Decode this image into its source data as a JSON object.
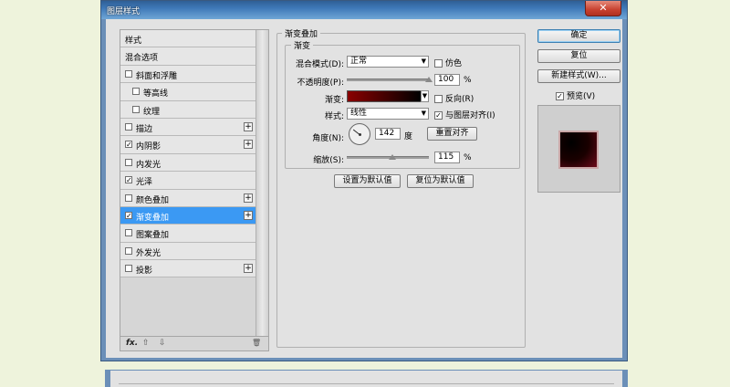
{
  "window": {
    "title": "图层样式",
    "close_symbol": "✕"
  },
  "styles_list": [
    {
      "label": "样式",
      "checkbox": false,
      "checked": false,
      "plus": false,
      "indent": 0,
      "selected": false
    },
    {
      "label": "混合选项",
      "checkbox": false,
      "checked": false,
      "plus": false,
      "indent": 0,
      "selected": false
    },
    {
      "label": "斜面和浮雕",
      "checkbox": true,
      "checked": false,
      "plus": false,
      "indent": 0,
      "selected": false
    },
    {
      "label": "等高线",
      "checkbox": true,
      "checked": false,
      "plus": false,
      "indent": 1,
      "selected": false
    },
    {
      "label": "纹理",
      "checkbox": true,
      "checked": false,
      "plus": false,
      "indent": 1,
      "selected": false
    },
    {
      "label": "描边",
      "checkbox": true,
      "checked": false,
      "plus": true,
      "indent": 0,
      "selected": false
    },
    {
      "label": "内阴影",
      "checkbox": true,
      "checked": true,
      "plus": true,
      "indent": 0,
      "selected": false
    },
    {
      "label": "内发光",
      "checkbox": true,
      "checked": false,
      "plus": false,
      "indent": 0,
      "selected": false
    },
    {
      "label": "光泽",
      "checkbox": true,
      "checked": true,
      "plus": false,
      "indent": 0,
      "selected": false
    },
    {
      "label": "颜色叠加",
      "checkbox": true,
      "checked": false,
      "plus": true,
      "indent": 0,
      "selected": false
    },
    {
      "label": "渐变叠加",
      "checkbox": true,
      "checked": true,
      "plus": true,
      "indent": 0,
      "selected": true
    },
    {
      "label": "图案叠加",
      "checkbox": true,
      "checked": false,
      "plus": false,
      "indent": 0,
      "selected": false
    },
    {
      "label": "外发光",
      "checkbox": true,
      "checked": false,
      "plus": false,
      "indent": 0,
      "selected": false
    },
    {
      "label": "投影",
      "checkbox": true,
      "checked": false,
      "plus": true,
      "indent": 0,
      "selected": false
    }
  ],
  "list_footer": {
    "fx": "fx.",
    "up": "⇧",
    "down": "⇩",
    "trash": "🗑"
  },
  "gradient_overlay": {
    "group_title": "渐变叠加",
    "sub_title": "渐变",
    "blend_mode_label": "混合模式(D):",
    "blend_mode_value": "正常",
    "dither_label": "仿色",
    "opacity_label": "不透明度(P):",
    "opacity_value": "100",
    "opacity_unit": "%",
    "opacity_fraction": 1.0,
    "gradient_label": "渐变:",
    "reverse_label": "反向(R)",
    "style_label": "样式:",
    "style_value": "线性",
    "align_label": "与图层对齐(I)",
    "angle_label": "角度(N):",
    "angle_value": "142",
    "angle_unit": "度",
    "reset_align_button": "重置对齐",
    "scale_label": "缩放(S):",
    "scale_value": "115",
    "scale_unit": "%",
    "scale_fraction": 0.55,
    "set_default_button": "设置为默认值",
    "reset_default_button": "复位为默认值"
  },
  "right_panel": {
    "ok_button": "确定",
    "reset_button": "复位",
    "new_style_button": "新建样式(W)...",
    "preview_label": "预览(V)",
    "preview_checked": true
  },
  "arrow_symbol": "▼",
  "check_symbol": "✓",
  "plus_symbol": "+"
}
